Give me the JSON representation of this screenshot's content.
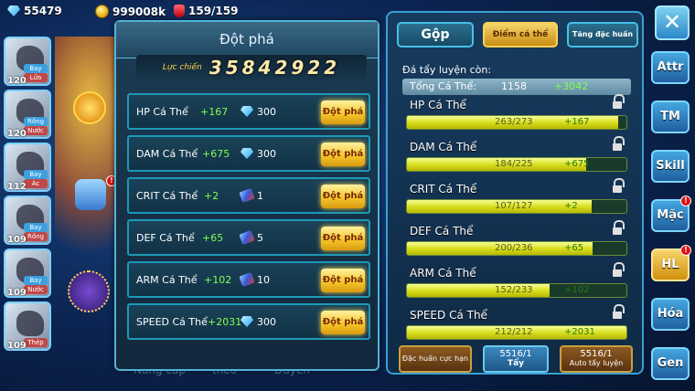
{
  "topbar": {
    "gems": "55479",
    "gold": "999008k",
    "stamina": "159/159"
  },
  "roster": [
    {
      "level": "120",
      "tag1": "Bay",
      "tag2": "Lửa"
    },
    {
      "level": "120",
      "tag1": "Rồng",
      "tag2": "Nước"
    },
    {
      "level": "112",
      "tag1": "Bay",
      "tag2": "Ác"
    },
    {
      "level": "109",
      "tag1": "Bay",
      "tag2": "Rồng"
    },
    {
      "level": "109",
      "tag1": "Bay",
      "tag2": "Nước"
    },
    {
      "level": "109",
      "tag1": "",
      "tag2": "Thép"
    }
  ],
  "background_footer": [
    "Nâng cấp",
    "theo",
    "Duyên"
  ],
  "breakthrough": {
    "title": "Đột phá",
    "power_label": "Lực chiến",
    "power_value": "35842922",
    "rows": [
      {
        "name": "HP Cá Thể",
        "bonus": "+167",
        "cost_icon": "gem-icon",
        "cost": "300",
        "button": "Đột phá"
      },
      {
        "name": "DAM Cá Thể",
        "bonus": "+675",
        "cost_icon": "gem-icon",
        "cost": "300",
        "button": "Đột phá"
      },
      {
        "name": "CRIT Cá Thể",
        "bonus": "+2",
        "cost_icon": "stone-icon",
        "cost": "1",
        "button": "Đột phá"
      },
      {
        "name": "DEF Cá Thể",
        "bonus": "+65",
        "cost_icon": "stone-icon",
        "cost": "5",
        "button": "Đột phá"
      },
      {
        "name": "ARM Cá Thể",
        "bonus": "+102",
        "cost_icon": "stone-icon",
        "cost": "10",
        "button": "Đột phá"
      },
      {
        "name": "SPEED Cá Thể",
        "bonus": "+2031",
        "cost_icon": "gem-icon",
        "cost": "300",
        "button": "Đột phá"
      }
    ]
  },
  "stats_panel": {
    "tabs": [
      {
        "label": "Gộp",
        "active": false
      },
      {
        "label": "Điểm cá thể",
        "active": true
      },
      {
        "label": "Tăng đặc huấn",
        "active": false
      }
    ],
    "remaining_label": "Đá tẩy luyện còn:",
    "total_label": "Tổng Cá Thể:",
    "total_value": "1158",
    "total_bonus": "+3042",
    "stats": [
      {
        "name": "HP Cá Thể",
        "value": "263/273",
        "bonus": "+167",
        "ratio": 0.963
      },
      {
        "name": "DAM Cá Thể",
        "value": "184/225",
        "bonus": "+675",
        "ratio": 0.818
      },
      {
        "name": "CRIT Cá Thể",
        "value": "107/127",
        "bonus": "+2",
        "ratio": 0.843
      },
      {
        "name": "DEF Cá Thể",
        "value": "200/236",
        "bonus": "+65",
        "ratio": 0.847
      },
      {
        "name": "ARM Cá Thể",
        "value": "152/233",
        "bonus": "+102",
        "ratio": 0.652
      },
      {
        "name": "SPEED Cá Thể",
        "value": "212/212",
        "bonus": "+2031",
        "ratio": 1.0
      }
    ],
    "buttons": {
      "special_training": "Đặc huấn cực hạn",
      "wash_count": "5516/1",
      "wash_label": "Tẩy",
      "auto_count": "5516/1",
      "auto_label": "Auto tẩy luyện"
    }
  },
  "side_tabs": [
    {
      "label": "Attr",
      "badge": false,
      "active": false
    },
    {
      "label": "TM",
      "badge": false,
      "active": false
    },
    {
      "label": "Skill",
      "badge": false,
      "active": false
    },
    {
      "label": "Mặc",
      "badge": true,
      "active": false
    },
    {
      "label": "HL",
      "badge": true,
      "active": true
    },
    {
      "label": "Hóa",
      "badge": false,
      "active": false
    },
    {
      "label": "Gen",
      "badge": false,
      "active": false
    }
  ]
}
